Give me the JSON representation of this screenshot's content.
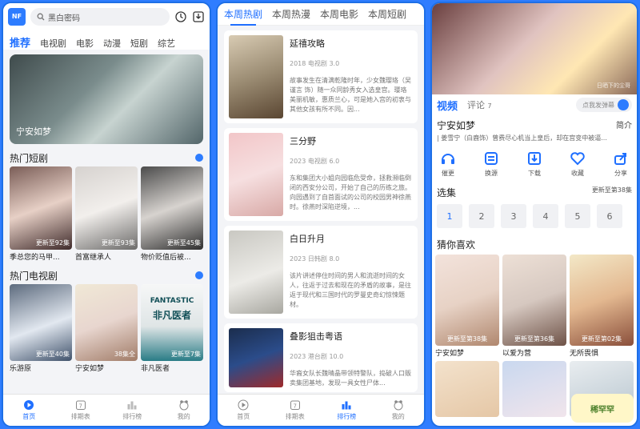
{
  "screen1": {
    "logo": "NF",
    "search_placeholder": "黑白密码",
    "categories": [
      "推荐",
      "电视剧",
      "电影",
      "动漫",
      "短剧",
      "综艺"
    ],
    "hero_title": "宁安如梦",
    "short_section_title": "热门短剧",
    "short_items": [
      {
        "title": "季总您的马甲...",
        "badge": "更新至92集"
      },
      {
        "title": "首富继承人",
        "badge": "更新至93集"
      },
      {
        "title": "物价贬值后被...",
        "badge": "更新至45集"
      }
    ],
    "tv_section_title": "热门电视剧",
    "tv_items": [
      {
        "title": "乐游原",
        "badge": "更新至40集"
      },
      {
        "title": "宁安如梦",
        "badge": "38集全"
      },
      {
        "title": "非凡医者",
        "badge": "更新至7集"
      }
    ],
    "tv_overlay_text": "FANTASTIC",
    "tv_overlay_text2": "非凡医者",
    "nav": [
      "首页",
      "排期表",
      "排行榜",
      "我的"
    ]
  },
  "screen2": {
    "tabs": [
      "本周热剧",
      "本周热漫",
      "本周电影",
      "本周短剧"
    ],
    "movies": [
      {
        "title": "延禧攻略",
        "meta": "2018 电视剧 3.0",
        "desc": "故事发生在清满乾隆时年，少女魏璎珞（吴谨言 饰）随一众同龄秀女入选皇宫。璎珞美丽机敏，惠质兰心，可是她入宫的初衷与其他女孩有所不同。因..."
      },
      {
        "title": "三分野",
        "meta": "2023 电视剧 6.0",
        "desc": "东和集团大小姐向园临危受命，拯救濒临倒闭的西安分公司，开始了自己的历练之旅。向园遇到了自首面试的公司的校园男神徐燕时。徐燕时深陷逆境，..."
      },
      {
        "title": "白日升月",
        "meta": "2023 日韩剧 8.0",
        "desc": "该片讲述停住时间的男人和流逝时间的女人，往返于过去和现在的矛盾的故事，是往返于现代和三国时代的罗曼史奇幻惊悚题材。"
      },
      {
        "title": "叠影狙击粤语",
        "meta": "2023 港台剧 10.0",
        "desc": "华裔女队长魏晴晶带领特警队，捣破人口贩卖集团基地，发现一具女性尸体..."
      }
    ],
    "nav": [
      "首页",
      "排期表",
      "排行榜",
      "我的"
    ]
  },
  "screen3": {
    "video_watermark": "日晒下的尘哥",
    "tab_video": "视频",
    "tab_comments": "评论",
    "comments_count": "7",
    "danmu_placeholder": "点我发弹幕",
    "title": "宁安如梦",
    "intro": "简介",
    "cast": "| 姜雪宁（白鹿饰）曾费尽心机当上皇后，却在宫变中被逼...",
    "actions": [
      "催更",
      "换源",
      "下载",
      "收藏",
      "分享"
    ],
    "episodes_title": "选集",
    "episodes_more": "更新至第38集",
    "episodes": [
      "1",
      "2",
      "3",
      "4",
      "5",
      "6"
    ],
    "like_title": "猜你喜欢",
    "like_items": [
      {
        "title": "宁安如梦",
        "badge": "更新至第38集"
      },
      {
        "title": "以爱为营",
        "badge": "更新至第36集"
      },
      {
        "title": "无所畏惧",
        "badge": "更新至第02集"
      }
    ],
    "mascot": "稀罕罕"
  }
}
